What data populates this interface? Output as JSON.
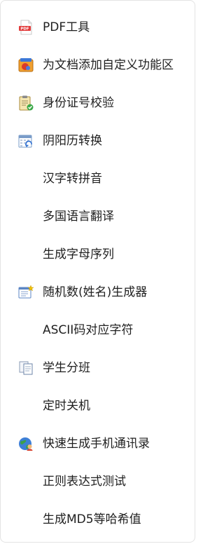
{
  "menu": {
    "items": [
      {
        "label": "PDF工具",
        "icon": "pdf-icon"
      },
      {
        "label": "为文档添加自定义功能区",
        "icon": "ribbon-icon"
      },
      {
        "label": "身份证号校验",
        "icon": "clipboard-check-icon"
      },
      {
        "label": "阴阳历转换",
        "icon": "calendar-convert-icon"
      },
      {
        "label": "汉字转拼音",
        "icon": ""
      },
      {
        "label": "多国语言翻译",
        "icon": ""
      },
      {
        "label": "生成字母序列",
        "icon": ""
      },
      {
        "label": "随机数(姓名)生成器",
        "icon": "random-generator-icon"
      },
      {
        "label": "ASCII码对应字符",
        "icon": ""
      },
      {
        "label": "学生分班",
        "icon": "document-split-icon"
      },
      {
        "label": "定时关机",
        "icon": ""
      },
      {
        "label": "快速生成手机通讯录",
        "icon": "contacts-globe-icon"
      },
      {
        "label": "正则表达式测试",
        "icon": ""
      },
      {
        "label": "生成MD5等哈希值",
        "icon": ""
      }
    ]
  }
}
